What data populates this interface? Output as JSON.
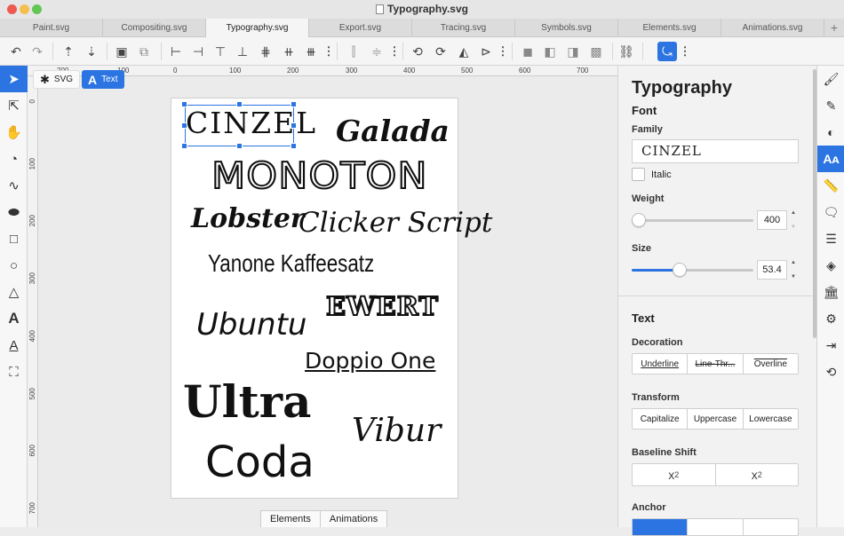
{
  "window": {
    "title": "Typography.svg"
  },
  "colors": {
    "accent": "#2b74e2",
    "close": "#ee5a52",
    "minimize": "#f5bf4f",
    "zoom": "#62c655"
  },
  "tabs": [
    {
      "label": "Paint.svg"
    },
    {
      "label": "Compositing.svg"
    },
    {
      "label": "Typography.svg",
      "active": true
    },
    {
      "label": "Export.svg"
    },
    {
      "label": "Tracing.svg"
    },
    {
      "label": "Symbols.svg"
    },
    {
      "label": "Elements.svg"
    },
    {
      "label": "Animations.svg"
    }
  ],
  "tab_add": "+",
  "toolbar": {
    "icons": [
      "undo-icon",
      "redo-icon",
      "upload-icon",
      "download-icon",
      "group-icon",
      "ungroup-icon",
      "align-left-icon",
      "align-center-horizontal-icon",
      "align-top-icon",
      "align-bottom-icon",
      "align-middle-icon",
      "distribute-horizontal-icon",
      "distribute-vertical-icon",
      "flip-horizontal-icon",
      "flip-vertical-icon",
      "rotate-left-icon",
      "rotate-right-icon",
      "mirror-icon",
      "send-icon",
      "union-icon",
      "difference-icon",
      "intersection-icon",
      "exclusion-icon",
      "link-icon",
      "path-icon"
    ]
  },
  "left_tools": [
    "pointer-icon",
    "node-icon",
    "hand-icon",
    "gradient-icon",
    "freehand-icon",
    "ellipse-fill-icon",
    "rect-icon",
    "circle-icon",
    "triangle-icon",
    "text-icon",
    "text-path-icon",
    "crop-icon"
  ],
  "modebar": {
    "svg": "SVG",
    "text": "Text"
  },
  "hruler": {
    "labels": [
      "200",
      "100",
      "0",
      "100",
      "200",
      "300",
      "400",
      "500",
      "600",
      "700"
    ]
  },
  "vruler": {
    "labels": [
      "0",
      "100",
      "200",
      "300",
      "400",
      "500",
      "600",
      "700"
    ]
  },
  "fonts": {
    "cinzel": "CINZEL",
    "galada": "Galada",
    "monoton": "MONOTON",
    "lobster": "Lobster",
    "clicker": "Clicker Script",
    "yanone": "Yanone Kaffeesatz",
    "ewert": "EWERT",
    "ubuntu": "Ubuntu",
    "doppio": "Doppio One",
    "ultra": "Ultra",
    "vibur": "Vibur",
    "coda": "Coda"
  },
  "bottom_tabs": {
    "elements": "Elements",
    "animations": "Animations"
  },
  "panel": {
    "title": "Typography",
    "font_heading": "Font",
    "family_label": "Family",
    "family_value": "CINZEL",
    "italic_label": "Italic",
    "weight_label": "Weight",
    "weight_value": "400",
    "weight_level": 0.0,
    "size_label": "Size",
    "size_value": "53.4",
    "size_level": 0.38,
    "text_heading": "Text",
    "decoration_label": "Decoration",
    "decoration": [
      "Underline",
      "Line-Thr...",
      "Overline"
    ],
    "transform_label": "Transform",
    "transform": [
      "Capitalize",
      "Uppercase",
      "Lowercase"
    ],
    "baseline_label": "Baseline Shift",
    "anchor_label": "Anchor"
  },
  "right_tools": [
    "fill-icon",
    "stroke-icon",
    "contrast-icon",
    "typography-icon",
    "ruler-icon",
    "comment-icon",
    "list-icon",
    "layers-icon",
    "library-icon",
    "settings-icon",
    "export-icon",
    "history-icon"
  ]
}
